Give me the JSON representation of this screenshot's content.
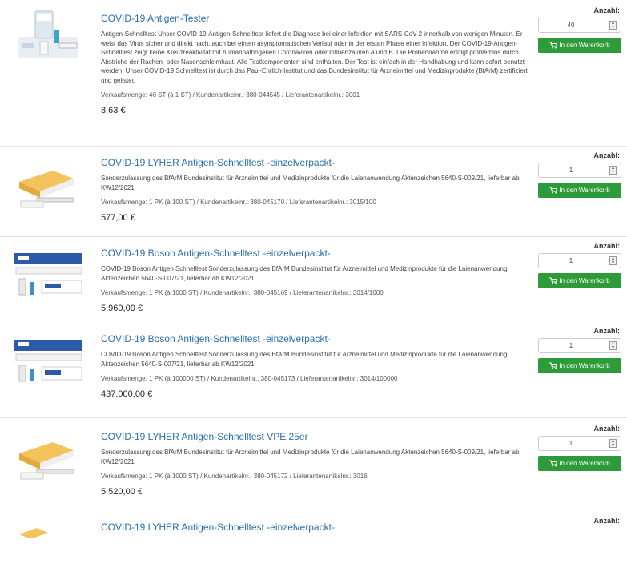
{
  "products": [
    {
      "title": "COVID-19 Antigen-Tester",
      "description": "Antigen-Schnelltest Unser COVID-19-Antigen-Schnelltest liefert die Diagnose bei einer Infektion mit SARS-CoV-2 innerhalb von wenigen Minuten. Er weist das Virus sicher und direkt nach, auch bei einem asymptomatischen Verlauf oder in der ersten Phase einer Infektion. Der COVID-19-Antigen-Schnelltest zeigt keine Kreuzreaktivität mit humanpathogenen Coronaviren oder Influenzaviren A und B. Die Probennahme erfolgt problemlos durch Abstriche der Rachen- oder Nasenschleimhaut. Alle Testkomponenten sind enthalten. Der Test ist einfach in der Handhabung und kann sofort benutzt werden. Unser COVID-19 Schnelltest ist durch das Paul-Ehrlich-Institut und das Bundesinstitut für Arzneimittel und Medizinprodukte (BfArM) zertifiziert und gelistet.",
      "meta": "Verkaufsmenge: 40 ST (à 1 ST) / Kundenartikelnr.: 380-044545 / Lieferantenartikelnr.: 3001",
      "price": "8,63 €",
      "qty": "40",
      "image": "tester"
    },
    {
      "title": "COVID-19 LYHER Antigen-Schnelltest -einzelverpackt-",
      "description": "Sonderzulassung des BfArM Bundesinstitut für Arzneimittel und Medizinprodukte für die Laienanwendung Aktenzeichen 5640-S-009/21, lieferbar ab KW12/2021",
      "meta": "Verkaufsmenge: 1 PK (à 100 ST) / Kundenartikelnr.: 380-045170 / Lieferantenartikelnr.: 3015/100",
      "price": "577,00 €",
      "qty": "1",
      "image": "lyher"
    },
    {
      "title": "COVID-19 Boson Antigen-Schnelltest -einzelverpackt-",
      "description": "COVID-19 Boson Antigen Schnelltest Sonderzulassung des BfArM Bundesinstitut für Arzneimittel und Medizinprodukte für die Laienanwendung Aktenzeichen 5640-S-007/21, lieferbar ab KW12/2021",
      "meta": "Verkaufsmenge: 1 PK (à 1000 ST) / Kundenartikelnr.: 380-045169 / Lieferantenartikelnr.: 3014/1000",
      "price": "5.960,00 €",
      "qty": "1",
      "image": "boson"
    },
    {
      "title": "COVID-19 Boson Antigen-Schnelltest -einzelverpackt-",
      "description": "COVID-19 Boson Antigen Schnelltest Sonderzulassung des BfArM Bundesinstitut für Arzneimittel und Medizinprodukte für die Laienanwendung Aktenzeichen 5640-S-007/21, lieferbar ab KW12/2021",
      "meta": "Verkaufsmenge: 1 PK (à 100000 ST) / Kundenartikelnr.: 380-045173 / Lieferantenartikelnr.: 3014/100000",
      "price": "437.000,00 €",
      "qty": "1",
      "image": "boson"
    },
    {
      "title": "COVID-19 LYHER Antigen-Schnelltest VPE 25er",
      "description": "Sonderzulassung des BfArM Bundesinstitut für Arzneimittel und Medizinprodukte für die Laienanwendung Aktenzeichen 5640-S-009/21, lieferbar ab KW12/2021",
      "meta": "Verkaufsmenge: 1 PK (à 1000 ST) / Kundenartikelnr.: 380-045172 / Lieferantenartikelnr.: 3016",
      "price": "5.520,00 €",
      "qty": "1",
      "image": "lyher"
    },
    {
      "title": "COVID-19 LYHER Antigen-Schnelltest -einzelverpackt-",
      "description": "",
      "meta": "",
      "price": "",
      "qty": "",
      "image": "lyher"
    }
  ],
  "labels": {
    "quantity": "Anzahl:",
    "add_to_cart": "In den Warenkorb"
  },
  "colors": {
    "link": "#2a6fb0",
    "cart_button": "#2e9b3a"
  },
  "icons": {
    "cart": "cart-icon",
    "spinner": "spinner-arrows-icon"
  }
}
